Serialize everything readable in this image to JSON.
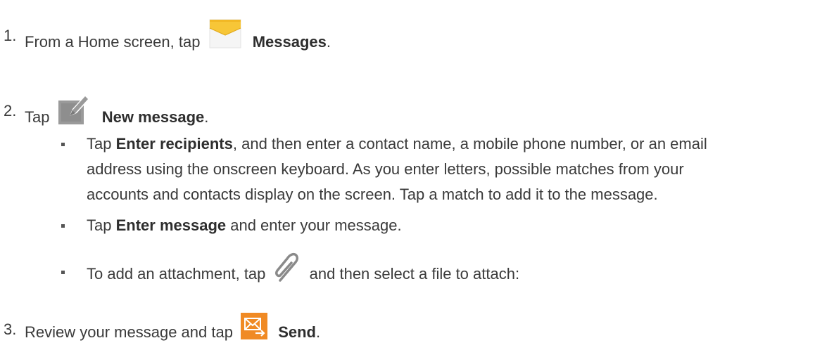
{
  "steps": [
    {
      "number": "1.",
      "before": "From a Home screen, tap",
      "icon": "messages-envelope-icon",
      "bold": "Messages",
      "after": "."
    },
    {
      "number": "2.",
      "before": "Tap",
      "icon": "new-message-pencil-icon",
      "bold": "New message",
      "after": "."
    },
    {
      "number": "3.",
      "before": "Review your message and tap",
      "icon": "send-icon",
      "bold": "Send",
      "after": "."
    }
  ],
  "bullets": [
    {
      "before": "Tap ",
      "bold": "Enter recipients",
      "after_line1": ", and then enter a contact name, a mobile phone number, or an email",
      "line2": "address using the onscreen keyboard. As you enter letters, possible matches from your",
      "line3": "accounts and contacts display on the screen. Tap a match to add it to the message."
    },
    {
      "before": "Tap ",
      "bold": "Enter message",
      "after": " and enter your message."
    },
    {
      "before": "To add an attachment, tap",
      "icon": "paperclip-icon",
      "after": "and then select a file to attach:"
    }
  ],
  "colors": {
    "text": "#3a3a3a",
    "messages_icon": "#f7c637",
    "pencil_icon": "#8a8a8a",
    "send_icon": "#f08a24"
  }
}
